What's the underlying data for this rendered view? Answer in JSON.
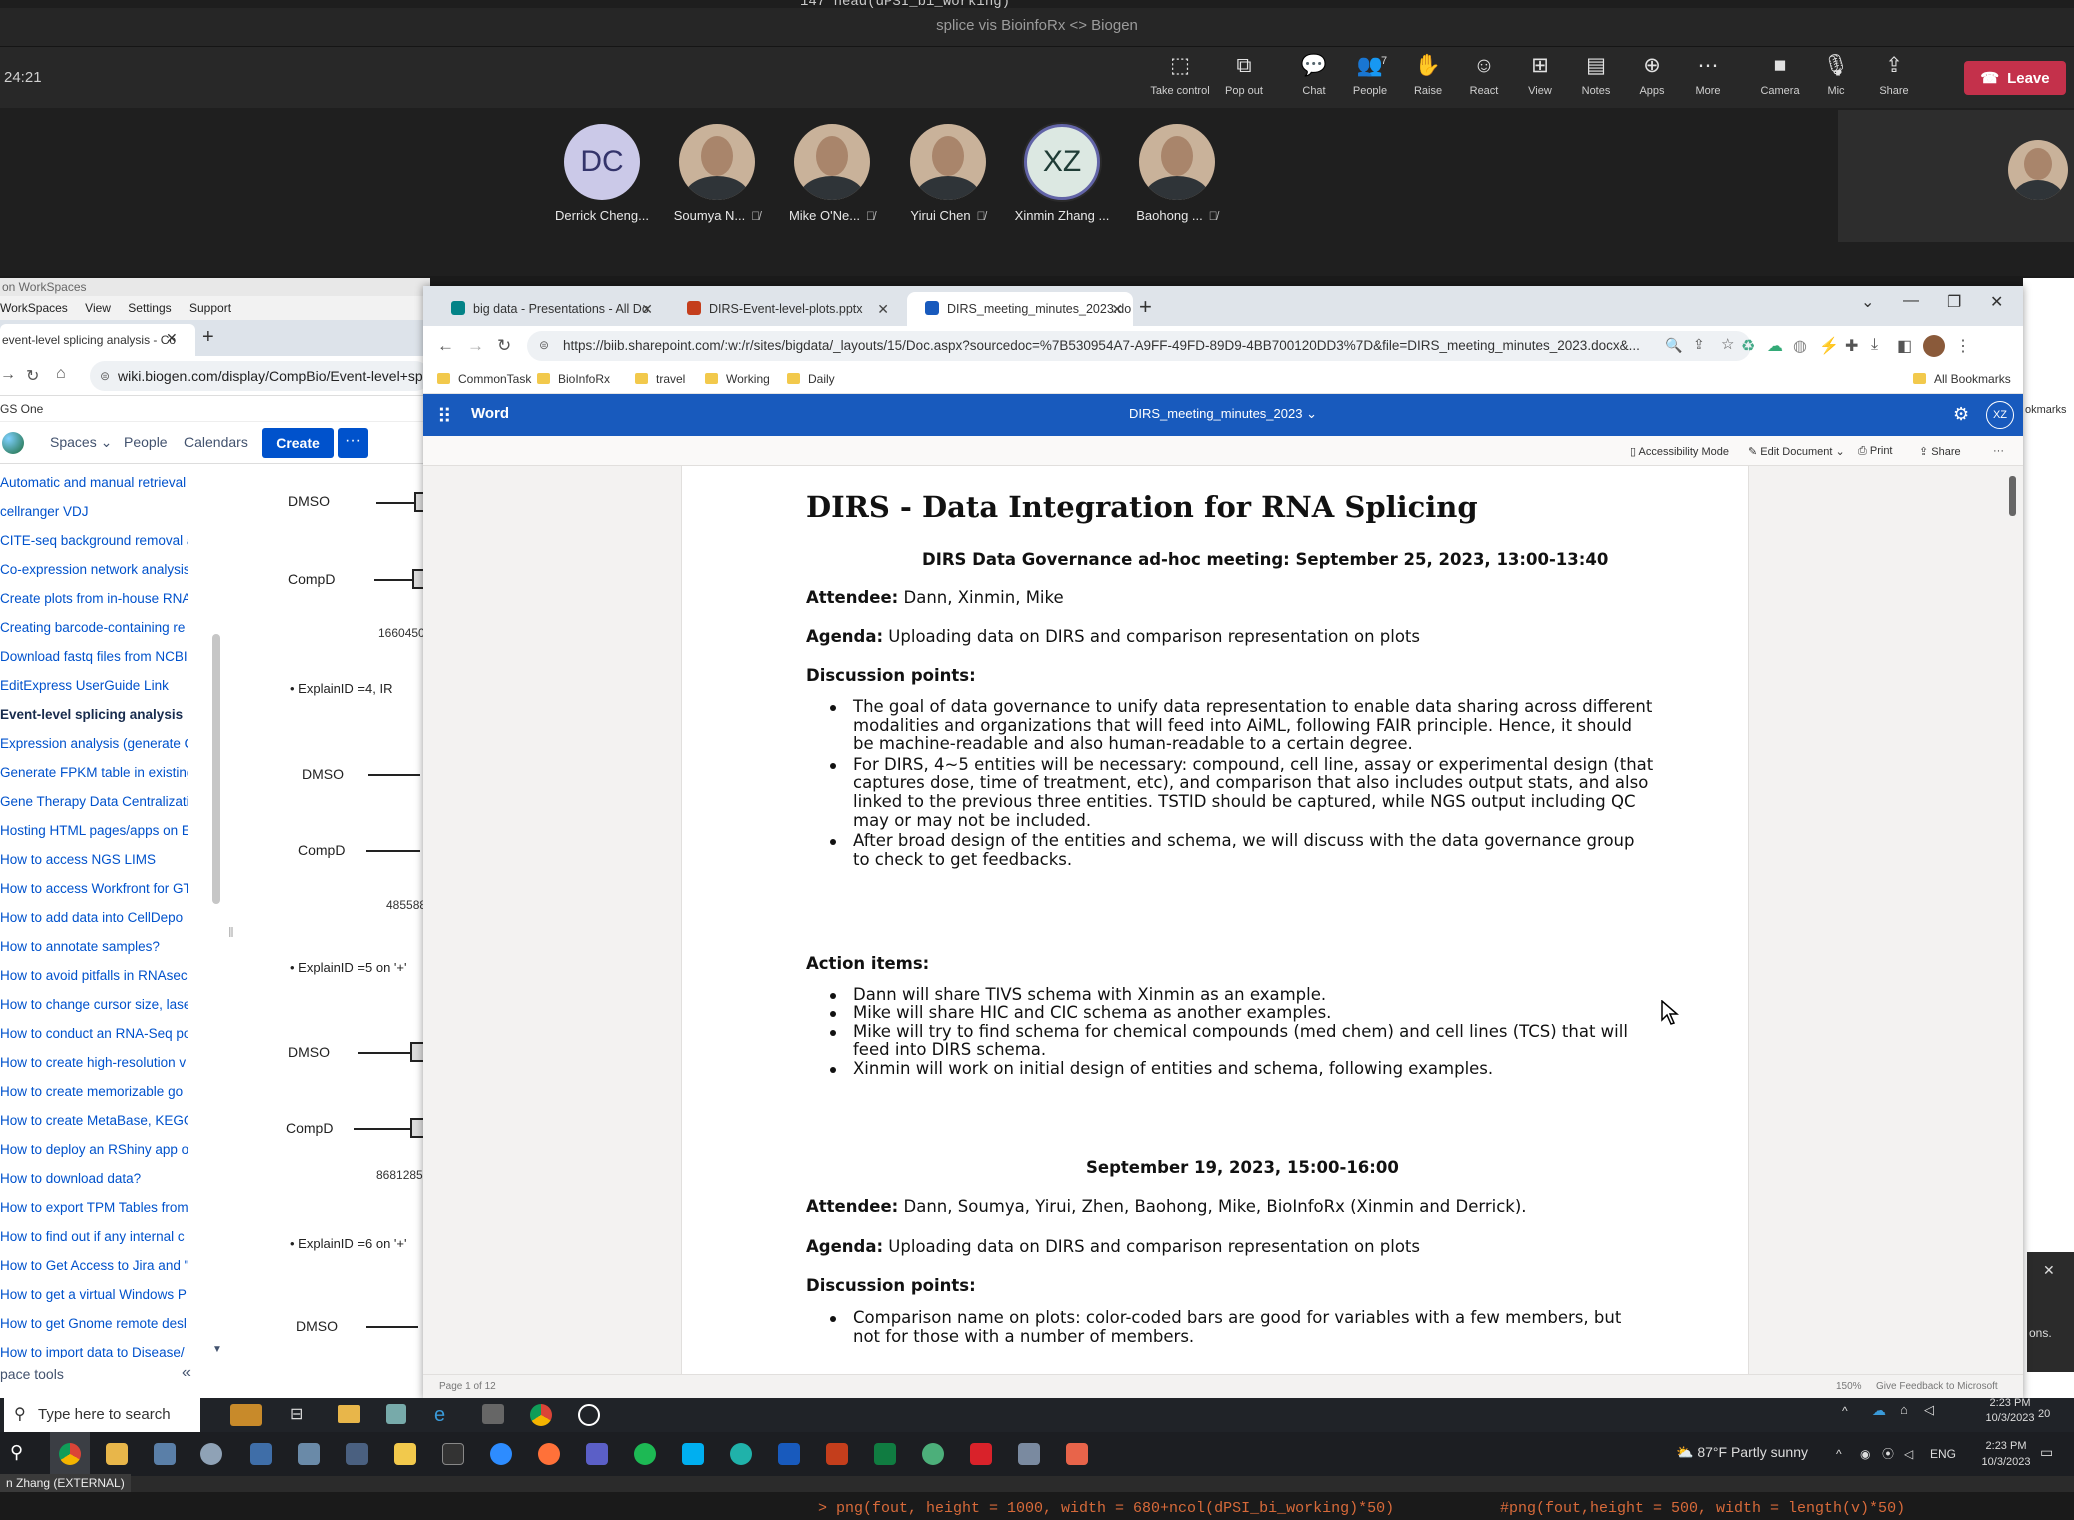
{
  "background_code": {
    "top": "147   head(dPSI_bi_working)",
    "bottom_left": "> png(fout, height = 1000, width = 680+ncol(dPSI_bi_working)*50)",
    "bottom_right": "#png(fout,height = 500, width = length(v)*50)"
  },
  "meeting": {
    "title": "splice vis BioinfoRx <> Biogen",
    "timer": "24:21",
    "toolbar": [
      {
        "icon": "take-control-icon",
        "glyph": "⬚",
        "label": "Take control"
      },
      {
        "icon": "pop-out-icon",
        "glyph": "⧉",
        "label": "Pop out"
      },
      {
        "icon": "chat-icon",
        "glyph": "💬",
        "label": "Chat"
      },
      {
        "icon": "people-icon",
        "glyph": "👥",
        "label": "People",
        "count": "7"
      },
      {
        "icon": "raise-hand-icon",
        "glyph": "✋",
        "label": "Raise"
      },
      {
        "icon": "react-icon",
        "glyph": "☺",
        "label": "React"
      },
      {
        "icon": "view-icon",
        "glyph": "⊞",
        "label": "View"
      },
      {
        "icon": "notes-icon",
        "glyph": "▤",
        "label": "Notes"
      },
      {
        "icon": "apps-icon",
        "glyph": "⊕",
        "label": "Apps"
      },
      {
        "icon": "more-icon",
        "glyph": "⋯",
        "label": "More"
      },
      {
        "icon": "camera-icon",
        "glyph": "■",
        "label": "Camera"
      },
      {
        "icon": "mic-icon",
        "glyph": "🎙",
        "label": "Mic"
      },
      {
        "icon": "share-icon",
        "glyph": "⇪",
        "label": "Share"
      }
    ],
    "leave_label": "Leave",
    "leave_color": "#c4314b",
    "participants": [
      {
        "initials": "DC",
        "name": "Derrick Cheng...",
        "muted": false,
        "type": "initials"
      },
      {
        "initials": "",
        "name": "Soumya N...",
        "muted": true,
        "type": "photo"
      },
      {
        "initials": "",
        "name": "Mike O'Ne...",
        "muted": true,
        "type": "photo"
      },
      {
        "initials": "",
        "name": "Yirui Chen",
        "muted": true,
        "type": "photo"
      },
      {
        "initials": "XZ",
        "name": "Xinmin Zhang ...",
        "muted": false,
        "type": "speaking"
      },
      {
        "initials": "",
        "name": "Baohong ...",
        "muted": true,
        "type": "photo"
      }
    ]
  },
  "left_window": {
    "title": "on WorkSpaces",
    "menu": [
      "WorkSpaces",
      "View",
      "Settings",
      "Support"
    ],
    "tab_label": "event-level splicing analysis - Co",
    "url": "wiki.biogen.com/display/CompBio/Event-level+spli",
    "bookmark": "GS One",
    "nav": {
      "spaces": "Spaces",
      "people": "People",
      "calendars": "Calendars",
      "create": "Create",
      "more": "···"
    },
    "sidebar_items": [
      "Automatic and manual retrieval",
      "cellranger VDJ",
      "CITE-seq background removal a",
      "Co-expression network analysis",
      "Create plots from in-house RNA",
      "Creating barcode-containing re",
      "Download fastq files from NCBI",
      "EditExpress UserGuide Link",
      "Event-level splicing analysis",
      "Expression analysis (generate Q",
      "Generate FPKM table in existing",
      "Gene Therapy Data Centralizati",
      "Hosting HTML pages/apps on E",
      "How to access NGS LIMS",
      "How to access Workfront for GT",
      "How to add data into CellDepo",
      "How to annotate samples?",
      "How to avoid pitfalls in RNAsec",
      "How to change cursor size, lase",
      "How to conduct an RNA-Seq po",
      "How to create high-resolution v",
      "How to create memorizable go",
      "How to create MetaBase, KEGG",
      "How to deploy an RShiny app o",
      "How to download data?",
      "How to export TPM Tables from",
      "How to find out if any internal c",
      "How to Get Access to Jira and \"",
      "How to get a virtual Windows P",
      "How to get Gnome remote desl",
      "How to import data to Disease/"
    ],
    "active_index": 8,
    "space_tools": "pace tools",
    "plot_labels": {
      "dmso": "DMSO",
      "compd": "CompD",
      "num1": "1660450",
      "num2": "485588",
      "num3": "8681285",
      "explain1": "ExplainID =4, IR",
      "explain2": "ExplainID =5 on '+'",
      "explain3": "ExplainID =6 on '+'"
    }
  },
  "browser": {
    "tabs": [
      {
        "label": "big data - Presentations - All Do",
        "icon_color": "#038387",
        "active": false
      },
      {
        "label": "DIRS-Event-level-plots.pptx",
        "icon_color": "#c43e1c",
        "active": false
      },
      {
        "label": "DIRS_meeting_minutes_2023.do",
        "icon_color": "#185abd",
        "active": true
      }
    ],
    "url": "https://biib.sharepoint.com/:w:/r/sites/bigdata/_layouts/15/Doc.aspx?sourcedoc=%7B530954A7-A9FF-49FD-89D9-4BB700120DD3%7D&file=DIRS_meeting_minutes_2023.docx&...",
    "bookmarks": [
      "CommonTask",
      "BioInfoRx",
      "travel",
      "Working",
      "Daily"
    ],
    "all_bookmarks": "All Bookmarks"
  },
  "word": {
    "app_name": "Word",
    "doc_title": "DIRS_meeting_minutes_2023 ⌄",
    "user_initials": "XZ",
    "brand_color": "#185abd",
    "commands": [
      "Accessibility Mode",
      "Edit Document ⌄",
      "Print",
      "Share",
      "···"
    ],
    "status_page": "Page 1 of 12",
    "status_zoom": "150%",
    "status_feedback": "Give Feedback to Microsoft"
  },
  "doc": {
    "title": "DIRS - Data Integration for RNA Splicing",
    "meeting1": {
      "heading": "DIRS Data Governance ad-hoc meeting: September 25, 2023, 13:00-13:40",
      "attendee_label": "Attendee:",
      "attendee": " Dann, Xinmin, Mike",
      "agenda_label": "Agenda:",
      "agenda": " Uploading data on DIRS and comparison representation on plots",
      "discussion_label": "Discussion points:",
      "discussion_lines": [
        "The goal of data governance to unify data representation to enable data sharing across different",
        "modalities and organizations that will feed into AiML, following FAIR principle. Hence, it should",
        "be machine-readable and also human-readable to a certain degree.",
        "For DIRS, 4~5 entities will be necessary: compound, cell line, assay or experimental design (that",
        "captures dose, time of treatment, etc), and comparison that also includes output stats, and also",
        "linked to the previous three entities. TSTID should be captured, while NGS output including QC",
        "may or may not be included.",
        "After broad design of the entities and schema, we will discuss with the data governance group",
        "to check to get feedbacks."
      ],
      "action_label": "Action items:",
      "action_lines": [
        "Dann will share TIVS schema with Xinmin as an example.",
        "Mike will share HIC and CIC schema as another examples.",
        "Mike will try to find schema for chemical compounds (med chem) and cell lines (TCS) that will",
        "feed into DIRS schema.",
        " Xinmin will work on initial design of entities and schema, following examples."
      ]
    },
    "meeting2": {
      "heading": "September 19, 2023, 15:00-16:00",
      "attendee_label": "Attendee:",
      "attendee": " Dann, Soumya, Yirui, Zhen, Baohong, Mike, BioInfoRx (Xinmin and Derrick).",
      "agenda_label": "Agenda:",
      "agenda": " Uploading data on DIRS and comparison representation on plots",
      "discussion_label": "Discussion points:",
      "discussion_lines": [
        "Comparison name on plots: color-coded bars are good for variables with a few members, but",
        "not for those with a number of members."
      ]
    }
  },
  "taskbar": {
    "search_placeholder": "Type here to search",
    "weather": "87°F  Partly sunny",
    "lang": "ENG",
    "time": "2:23 PM",
    "date": "10/3/2023",
    "notif": "20",
    "user_label": "n Zhang (EXTERNAL)"
  },
  "right_panel": {
    "bookmarks": "okmarks",
    "notice": "ons."
  }
}
